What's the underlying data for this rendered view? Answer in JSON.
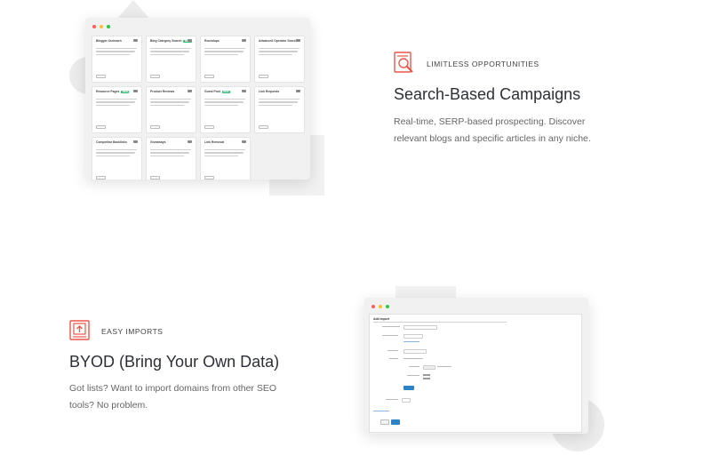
{
  "feature1": {
    "eyebrow": "LIMITLESS OPPORTUNITIES",
    "title": "Search-Based Campaigns",
    "description": "Real-time, SERP-based prospecting. Discover relevant blogs and specific articles in any niche.",
    "icon": "magnifier-page-icon",
    "accent": "#e8574a"
  },
  "feature2": {
    "eyebrow": "EASY IMPORTS",
    "title": "BYOD (Bring Your Own Data)",
    "description": "Got lists? Want to import domains from other SEO tools? No problem.",
    "icon": "upload-box-icon",
    "accent": "#e8574a"
  },
  "mock1": {
    "cards": [
      {
        "title": "Blogger Outreach",
        "tag": ""
      },
      {
        "title": "Blog Category Search",
        "tag": "NEW"
      },
      {
        "title": "Roundups",
        "tag": ""
      },
      {
        "title": "Advanced Operator Search",
        "tag": ""
      },
      {
        "title": "Resource Pages",
        "tag": "NEW"
      },
      {
        "title": "Product Reviews",
        "tag": ""
      },
      {
        "title": "Guest Post",
        "tag": "NEW"
      },
      {
        "title": "Link Requests",
        "tag": ""
      },
      {
        "title": "Competitor Backlinks",
        "tag": ""
      },
      {
        "title": "Giveaways",
        "tag": ""
      },
      {
        "title": "Link Removal",
        "tag": ""
      }
    ]
  },
  "mock2": {
    "heading": "Add Import"
  },
  "colors": {
    "dot_red": "#ff5f57",
    "dot_yellow": "#febc2e",
    "dot_green": "#28c840"
  }
}
